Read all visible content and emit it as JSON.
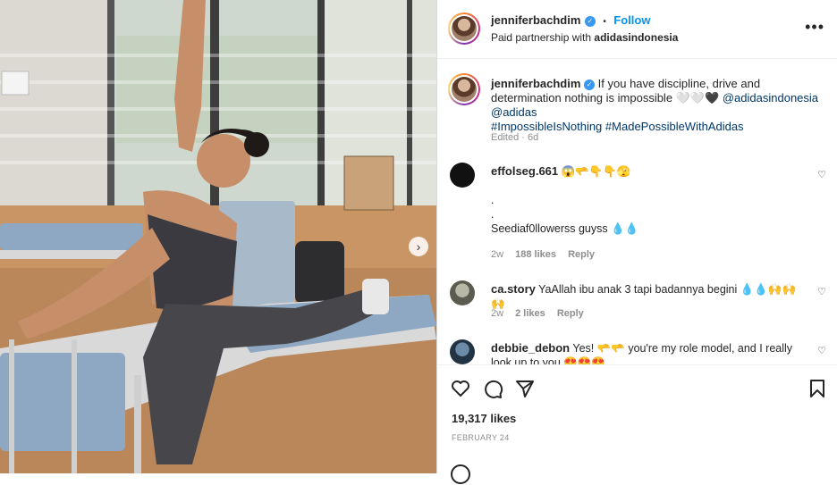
{
  "post": {
    "username": "jenniferbachdim",
    "verified_mark": "✓",
    "dot": "•",
    "follow_label": "Follow",
    "subtitle_prefix": "Paid partnership with",
    "partner": "adidasindonesia",
    "more_icon": "more-icon"
  },
  "caption": {
    "username": "jenniferbachdim",
    "text": "If you have discipline, drive and determination nothing is impossible 🤍🤍🖤",
    "mention1": "@adidasindonesia",
    "mention2": "@adidas",
    "hashtag1": "#ImpossibleIsNothing",
    "hashtag2": "#MadePossibleWithAdidas",
    "edited": "Edited",
    "age": "6d"
  },
  "comments": [
    {
      "username": "effolseg.661",
      "emoji": "😱🫳👇👇🫣",
      "line1": ".",
      "line2": ".",
      "body": "Seediaf0llowerss guyss 💧💧",
      "age": "2w",
      "likes": "188 likes",
      "reply": "Reply"
    },
    {
      "username": "ca.story",
      "body": "YaAllah ibu anak 3 tapi badannya begini 💧💧🙌🙌🙌",
      "age": "2w",
      "likes": "2 likes",
      "reply": "Reply"
    },
    {
      "username": "debbie_debon",
      "body": "Yes! 🫳🫳 you're my role model, and I really look up to you 😍😍😍"
    }
  ],
  "actions": {
    "likes": "19,317 likes",
    "date": "FEBRUARY 24"
  },
  "colors": {
    "link": "#00376b",
    "follow": "#0095f6",
    "verified": "#3897f0"
  }
}
